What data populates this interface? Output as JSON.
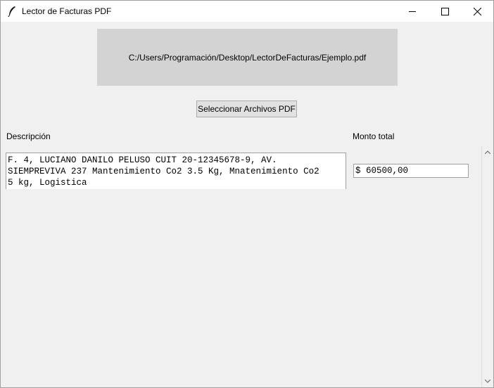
{
  "window": {
    "title": "Lector de Facturas PDF",
    "icon": "feather-icon"
  },
  "file_path_label": "C:/Users/Programación/Desktop/LectorDeFacturas/Ejemplo.pdf",
  "select_button_label": "Seleccionar Archivos PDF",
  "descripcion": {
    "label": "Descripción",
    "value": "F. 4, LUCIANO DANILO PELUSO CUIT 20-12345678-9, AV.\nSIEMPREVIVA 237 Mantenimiento Co2 3.5 Kg, Mnatenimiento Co2\n5 kg, Logistica"
  },
  "monto_total": {
    "label": "Monto total",
    "value": "$ 60500,00"
  },
  "colors": {
    "path_bg": "#d3d3d3",
    "window_bg": "#f0f0f0"
  }
}
